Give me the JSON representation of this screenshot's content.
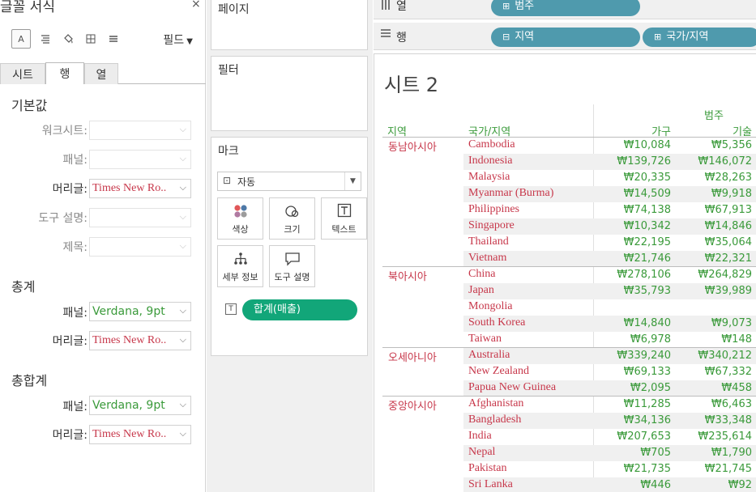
{
  "format_pane": {
    "title": "글꼴 서식",
    "close": "×",
    "field_button": "필드",
    "tabs": [
      "시트",
      "행",
      "열"
    ],
    "default_section": {
      "title": "기본값",
      "rows": [
        {
          "label": "워크시트:",
          "value": ""
        },
        {
          "label": "패널:",
          "value": ""
        },
        {
          "label": "머리글:",
          "value": "Times New Ro.."
        },
        {
          "label": "도구 설명:",
          "value": ""
        },
        {
          "label": "제목:",
          "value": ""
        }
      ]
    },
    "total_section": {
      "title": "총계",
      "rows": [
        {
          "label": "패널:",
          "value": "Verdana, 9pt"
        },
        {
          "label": "머리글:",
          "value": "Times New Ro.."
        }
      ]
    },
    "grand_total_section": {
      "title": "총합계",
      "rows": [
        {
          "label": "패널:",
          "value": "Verdana, 9pt"
        },
        {
          "label": "머리글:",
          "value": "Times New Ro.."
        }
      ]
    }
  },
  "cards": {
    "pages": "페이지",
    "filters": "필터",
    "marks": {
      "title": "마크",
      "type": "자동",
      "buttons": [
        "색상",
        "크기",
        "텍스트",
        "세부 정보",
        "도구 설명"
      ],
      "pill": "합계(매출)"
    }
  },
  "shelves": {
    "columns": {
      "label": "열",
      "pills": [
        "범주"
      ]
    },
    "rows": {
      "label": "행",
      "pills": [
        "지역",
        "국가/지역"
      ]
    }
  },
  "view": {
    "title": "시트 2",
    "header_group": "범주",
    "headers": {
      "region": "지역",
      "country": "국가/지역",
      "col1": "가구",
      "col2": "기술"
    },
    "groups": [
      {
        "region": "동남아시아",
        "rows": [
          {
            "country": "Cambodia",
            "v1": "₩10,084",
            "v2": "₩5,356"
          },
          {
            "country": "Indonesia",
            "v1": "₩139,726",
            "v2": "₩146,072"
          },
          {
            "country": "Malaysia",
            "v1": "₩20,335",
            "v2": "₩28,263"
          },
          {
            "country": "Myanmar (Burma)",
            "v1": "₩14,509",
            "v2": "₩9,918"
          },
          {
            "country": "Philippines",
            "v1": "₩74,138",
            "v2": "₩67,913"
          },
          {
            "country": "Singapore",
            "v1": "₩10,342",
            "v2": "₩14,846"
          },
          {
            "country": "Thailand",
            "v1": "₩22,195",
            "v2": "₩35,064"
          },
          {
            "country": "Vietnam",
            "v1": "₩21,746",
            "v2": "₩22,321"
          }
        ]
      },
      {
        "region": "북아시아",
        "rows": [
          {
            "country": "China",
            "v1": "₩278,106",
            "v2": "₩264,829"
          },
          {
            "country": "Japan",
            "v1": "₩35,793",
            "v2": "₩39,989"
          },
          {
            "country": "Mongolia",
            "v1": "",
            "v2": ""
          },
          {
            "country": "South Korea",
            "v1": "₩14,840",
            "v2": "₩9,073"
          },
          {
            "country": "Taiwan",
            "v1": "₩6,978",
            "v2": "₩148"
          }
        ]
      },
      {
        "region": "오세아니아",
        "rows": [
          {
            "country": "Australia",
            "v1": "₩339,240",
            "v2": "₩340,212"
          },
          {
            "country": "New Zealand",
            "v1": "₩69,133",
            "v2": "₩67,332"
          },
          {
            "country": "Papua New Guinea",
            "v1": "₩2,095",
            "v2": "₩458"
          }
        ]
      },
      {
        "region": "중앙아시아",
        "rows": [
          {
            "country": "Afghanistan",
            "v1": "₩11,285",
            "v2": "₩6,463"
          },
          {
            "country": "Bangladesh",
            "v1": "₩34,136",
            "v2": "₩33,348"
          },
          {
            "country": "India",
            "v1": "₩207,653",
            "v2": "₩235,614"
          },
          {
            "country": "Nepal",
            "v1": "₩705",
            "v2": "₩1,790"
          },
          {
            "country": "Pakistan",
            "v1": "₩21,735",
            "v2": "₩21,745"
          },
          {
            "country": "Sri Lanka",
            "v1": "₩446",
            "v2": "₩92"
          }
        ]
      }
    ]
  }
}
